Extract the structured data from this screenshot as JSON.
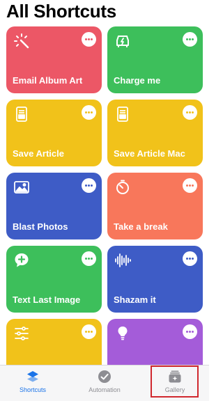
{
  "page_title": "All Shortcuts",
  "shortcuts": [
    {
      "label": "Email Album Art",
      "color": "#ec5766",
      "icon": "sparkle-wand-icon"
    },
    {
      "label": "Charge me",
      "color": "#3dbf5b",
      "icon": "car-charging-icon"
    },
    {
      "label": "Save Article",
      "color": "#f1c21a",
      "icon": "reader-article-icon"
    },
    {
      "label": "Save Article Mac",
      "color": "#f1c21a",
      "icon": "reader-article-icon"
    },
    {
      "label": "Blast Photos",
      "color": "#3e5cc6",
      "icon": "photo-icon"
    },
    {
      "label": "Take a break",
      "color": "#f8775b",
      "icon": "timer-icon"
    },
    {
      "label": "Text Last Image",
      "color": "#3dbf5b",
      "icon": "message-add-icon"
    },
    {
      "label": "Shazam it",
      "color": "#3e5cc6",
      "icon": "waveform-icon"
    },
    {
      "label": "",
      "color": "#f1c21a",
      "icon": "sliders-icon"
    },
    {
      "label": "",
      "color": "#a45cd9",
      "icon": "lightbulb-icon"
    }
  ],
  "tabbar": {
    "tabs": [
      {
        "label": "Shortcuts",
        "icon": "layers-icon",
        "active": true
      },
      {
        "label": "Automation",
        "icon": "checkmark-circle-icon",
        "active": false
      },
      {
        "label": "Gallery",
        "icon": "gallery-stack-icon",
        "active": false
      }
    ],
    "active_color": "#1a73e8",
    "inactive_color": "#8e8e93",
    "highlight_color": "#d0282e"
  }
}
